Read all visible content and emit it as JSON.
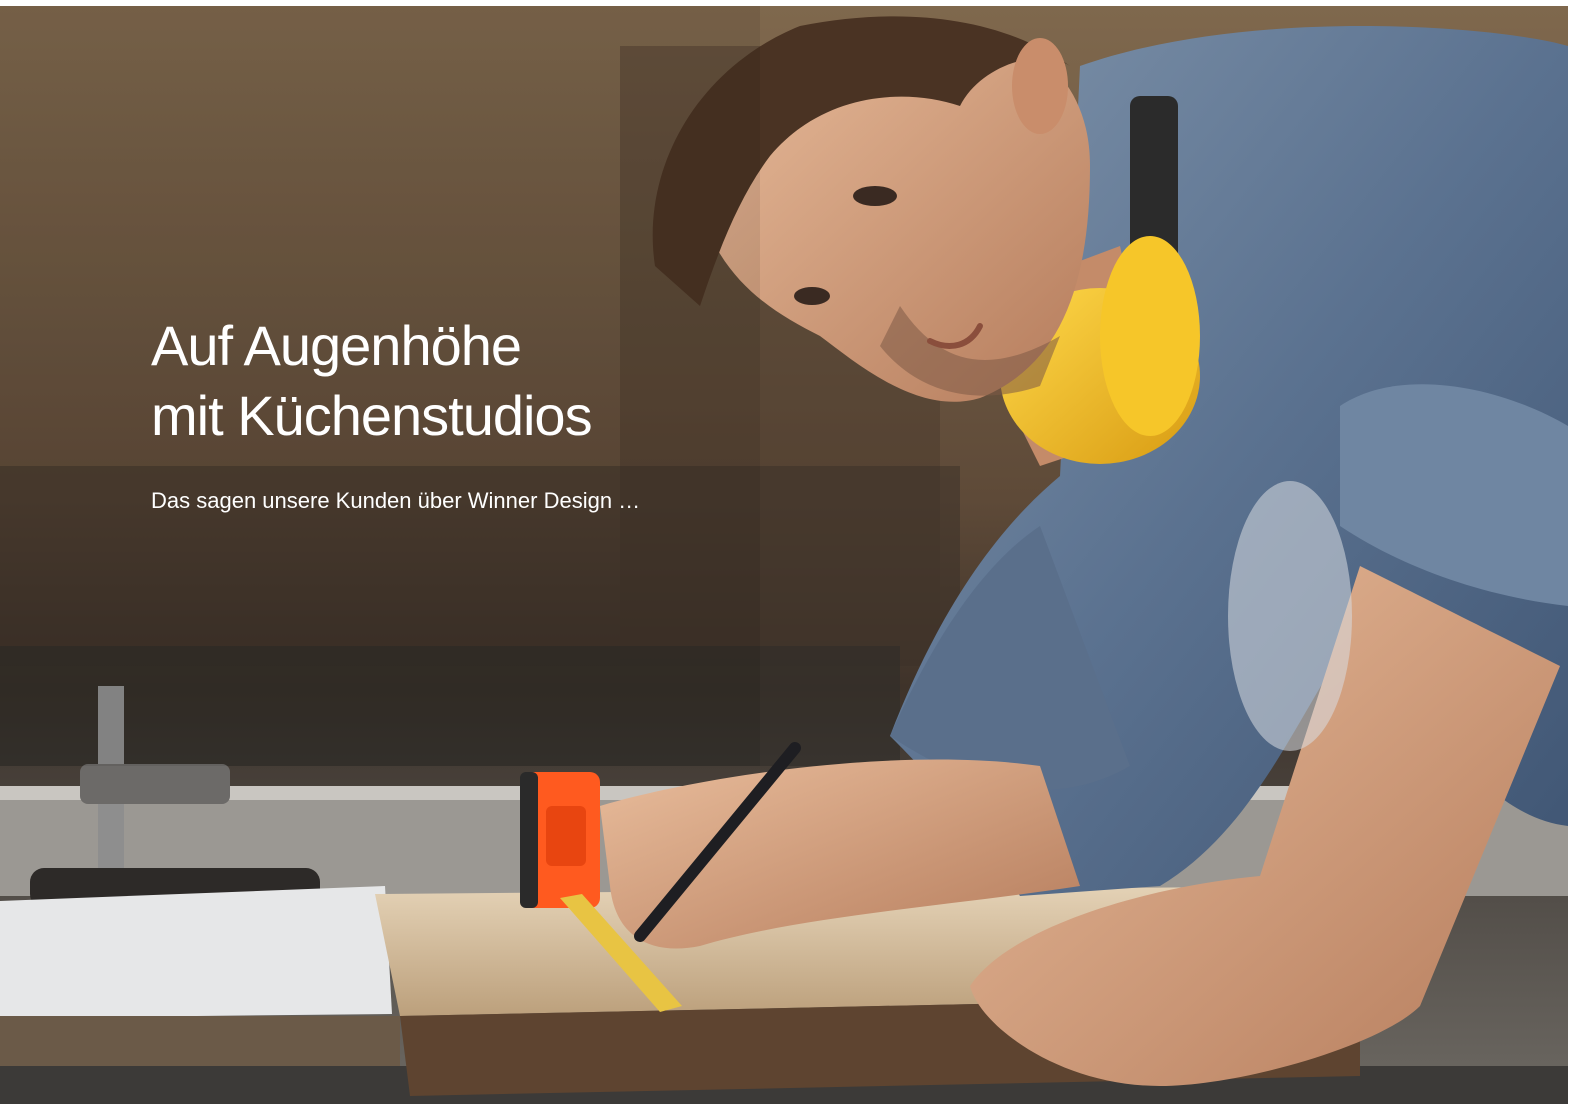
{
  "hero": {
    "headline_line1": "Auf Augenhöhe",
    "headline_line2": "mit Küchenstudios",
    "subline": "Das sagen unsere Kunden über Winner Design …"
  },
  "colors": {
    "text": "#ffffff",
    "background_warm": "#7a6248",
    "shirt_denim": "#5f7896",
    "earmuff_yellow": "#f2c22e",
    "tape_orange": "#ff5a1f",
    "board_wood": "#d9c4a6"
  }
}
